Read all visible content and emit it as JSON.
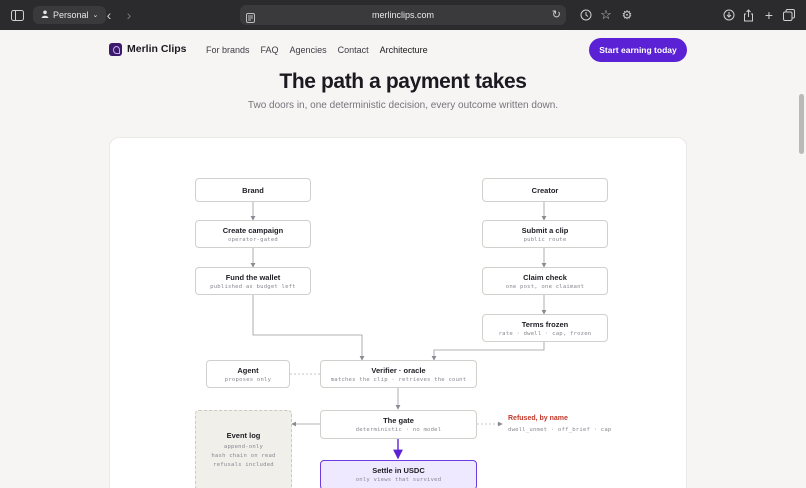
{
  "browser": {
    "profile_label": "Personal",
    "url": "merlinclips.com"
  },
  "nav": {
    "brand": "Merlin Clips",
    "links": [
      "For brands",
      "FAQ",
      "Agencies",
      "Contact",
      "Architecture"
    ],
    "cta": "Start earning today"
  },
  "hero": {
    "title": "The path a payment takes",
    "subtitle": "Two doors in, one deterministic decision, every outcome written down."
  },
  "diagram": {
    "brand": {
      "title": "Brand"
    },
    "creator": {
      "title": "Creator"
    },
    "create_campaign": {
      "title": "Create campaign",
      "sub": "operator-gated"
    },
    "fund_wallet": {
      "title": "Fund the wallet",
      "sub": "published as budget left"
    },
    "submit_clip": {
      "title": "Submit a clip",
      "sub": "public route"
    },
    "claim_check": {
      "title": "Claim check",
      "sub": "one post, one claimant"
    },
    "terms_frozen": {
      "title": "Terms frozen",
      "sub": "rate · dwell · cap, frozen"
    },
    "agent": {
      "title": "Agent",
      "sub": "proposes only"
    },
    "verifier": {
      "title": "Verifier · oracle",
      "sub": "matches the clip · retrieves the count"
    },
    "gate": {
      "title": "The gate",
      "sub": "deterministic · no model"
    },
    "refused": {
      "title": "Refused, by name",
      "sub": "dwell_unmet · off_brief · cap"
    },
    "event_log": {
      "title": "Event log",
      "lines": [
        "append-only",
        "hash chain on read",
        "refusals included"
      ]
    },
    "settle": {
      "title": "Settle in USDC",
      "sub": "only views that survived"
    }
  }
}
